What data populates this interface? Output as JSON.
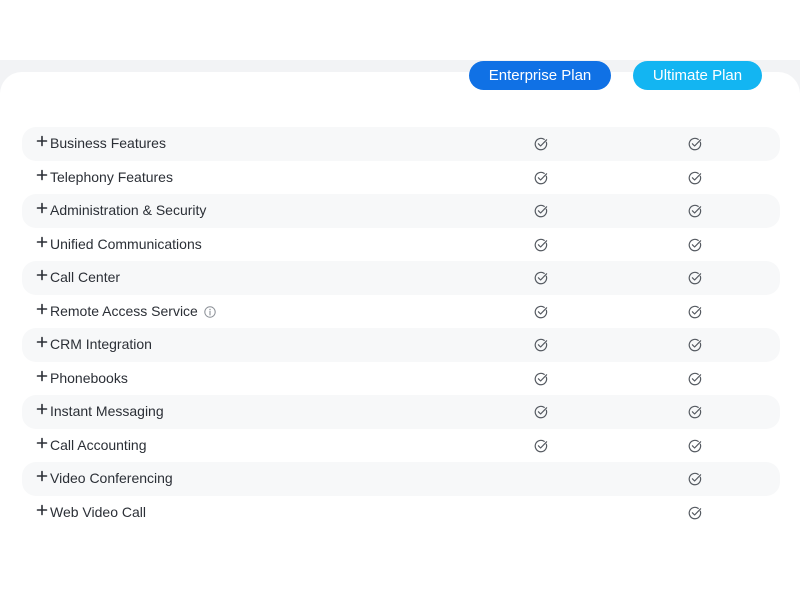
{
  "plans": {
    "enterprise_label": "Enterprise Plan",
    "ultimate_label": "Ultimate Plan"
  },
  "colors": {
    "enterprise": "#1071e5",
    "ultimate": "#13b5f2",
    "row_shade": "#f7f8f9",
    "text": "#2b2f36",
    "check": "#555a61"
  },
  "features": [
    {
      "label": "Business Features",
      "enterprise": true,
      "ultimate": true,
      "info": false
    },
    {
      "label": "Telephony Features",
      "enterprise": true,
      "ultimate": true,
      "info": false
    },
    {
      "label": "Administration & Security",
      "enterprise": true,
      "ultimate": true,
      "info": false
    },
    {
      "label": "Unified Communications",
      "enterprise": true,
      "ultimate": true,
      "info": false
    },
    {
      "label": "Call Center",
      "enterprise": true,
      "ultimate": true,
      "info": false
    },
    {
      "label": "Remote Access Service",
      "enterprise": true,
      "ultimate": true,
      "info": true
    },
    {
      "label": "CRM Integration",
      "enterprise": true,
      "ultimate": true,
      "info": false
    },
    {
      "label": "Phonebooks",
      "enterprise": true,
      "ultimate": true,
      "info": false
    },
    {
      "label": "Instant Messaging",
      "enterprise": true,
      "ultimate": true,
      "info": false
    },
    {
      "label": "Call Accounting",
      "enterprise": true,
      "ultimate": true,
      "info": false
    },
    {
      "label": "Video Conferencing",
      "enterprise": false,
      "ultimate": true,
      "info": false
    },
    {
      "label": "Web Video Call",
      "enterprise": false,
      "ultimate": true,
      "info": false
    }
  ],
  "icons": {
    "expand": "plus-icon",
    "included": "check-circle-icon",
    "info": "info-icon"
  }
}
